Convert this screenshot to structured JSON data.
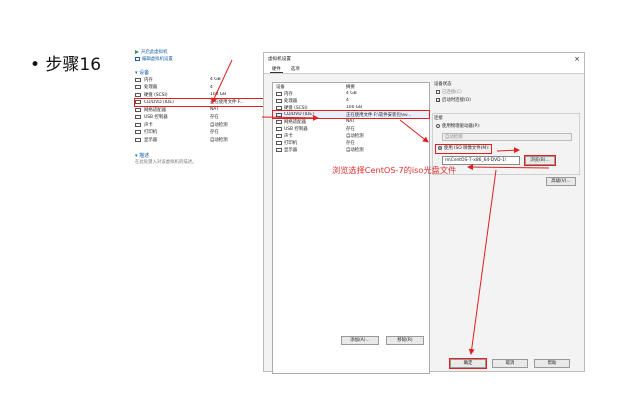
{
  "slide": {
    "title": "• 步骤16"
  },
  "left_panel": {
    "actions": [
      "开启此虚拟机",
      "编辑虚拟机设置"
    ],
    "section_devices": "▾ 设备",
    "devices": [
      {
        "icon": "memory-icon",
        "name": "内存",
        "value": "4 GB"
      },
      {
        "icon": "cpu-icon",
        "name": "处理器",
        "value": "4"
      },
      {
        "icon": "disk-icon",
        "name": "硬盘 (SCSI)",
        "value": "100 GB"
      },
      {
        "icon": "cd-icon",
        "name": "CD/DVD (IDE)",
        "value": "正在使用文件 F..."
      },
      {
        "icon": "network-icon",
        "name": "网络适配器",
        "value": "NAT"
      },
      {
        "icon": "usb-icon",
        "name": "USB 控制器",
        "value": "存在"
      },
      {
        "icon": "sound-icon",
        "name": "声卡",
        "value": "自动检测"
      },
      {
        "icon": "printer-icon",
        "name": "打印机",
        "value": "存在"
      },
      {
        "icon": "display-icon",
        "name": "显示器",
        "value": "自动检测"
      }
    ],
    "section_desc": "▾ 描述",
    "desc_text": "在此处键入对该虚拟机的描述。"
  },
  "dialog": {
    "title": "虚拟机设置",
    "close": "×",
    "tabs": [
      "硬件",
      "选项"
    ],
    "table_headers": [
      "设备",
      "摘要"
    ],
    "devices": [
      {
        "icon": "memory-icon",
        "name": "内存",
        "value": "4 GB"
      },
      {
        "icon": "cpu-icon",
        "name": "处理器",
        "value": "4"
      },
      {
        "icon": "disk-icon",
        "name": "硬盘 (SCSI)",
        "value": "100 GB"
      },
      {
        "icon": "cd-icon",
        "name": "CD/DVD (IDE)",
        "value": "正在使用文件 F:\\软件安装包\\ev..."
      },
      {
        "icon": "network-icon",
        "name": "网络适配器",
        "value": "NAT"
      },
      {
        "icon": "usb-icon",
        "name": "USB 控制器",
        "value": "存在"
      },
      {
        "icon": "sound-icon",
        "name": "声卡",
        "value": "自动检测"
      },
      {
        "icon": "printer-icon",
        "name": "打印机",
        "value": "存在"
      },
      {
        "icon": "display-icon",
        "name": "显示器",
        "value": "自动检测"
      }
    ],
    "add_btn": "添加(A)...",
    "remove_btn": "移除(R)",
    "status_title": "设备状态",
    "connected": "已连接(C)",
    "connect_on_start": "启动时连接(O)",
    "connection_title": "连接",
    "physical_drive": "使用物理驱动器(P):",
    "auto_detect": "自动检测",
    "use_iso": "使用 ISO 映像文件(M):",
    "iso_path": "m\\CentOS-7-x86_64-DVD-1!",
    "browse_btn": "浏览(B)...",
    "advanced_btn": "高级(V)...",
    "ok_btn": "确定",
    "cancel_btn": "取消",
    "help_btn": "帮助"
  },
  "annotation": "浏览选择CentOS-7的iso光盘文件",
  "colors": {
    "annotation": "#e03030",
    "link": "#1a5fa8"
  }
}
